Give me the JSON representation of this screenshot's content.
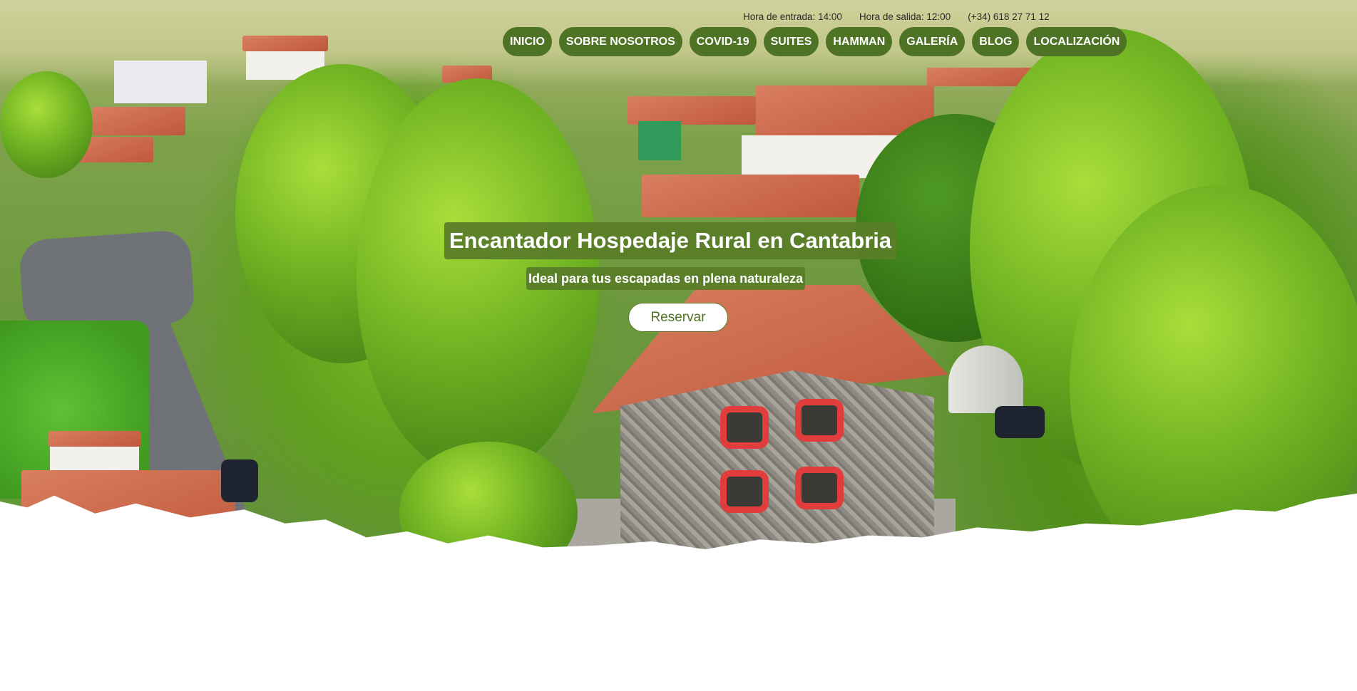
{
  "topbar": {
    "checkin": "Hora de entrada: 14:00",
    "checkout": "Hora de salida: 12:00",
    "phone": "(+34) 618 27 71 12"
  },
  "nav": {
    "items": [
      {
        "label": "INICIO"
      },
      {
        "label": "SOBRE NOSOTROS"
      },
      {
        "label": "COVID-19"
      },
      {
        "label": "SUITES"
      },
      {
        "label": "HAMMAN"
      },
      {
        "label": "GALERÍA"
      },
      {
        "label": "BLOG"
      },
      {
        "label": "LOCALIZACIÓN"
      }
    ]
  },
  "hero": {
    "title": "Encantador Hospedaje Rural en Cantabria",
    "subtitle": "Ideal para tus escapadas en plena naturaleza",
    "cta_label": "Reservar"
  },
  "colors": {
    "accent_green": "#4f7324",
    "text_white": "#ffffff",
    "info_text": "#2b2b2b"
  }
}
